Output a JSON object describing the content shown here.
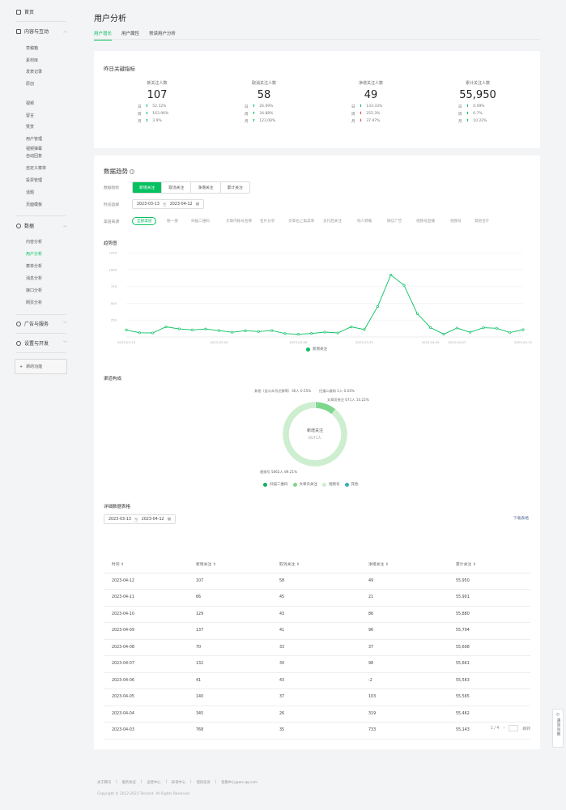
{
  "sidebar": {
    "home": "首页",
    "content": {
      "label": "内容与互动",
      "items": [
        "草稿箱",
        "素材库",
        "发表记录",
        "原创"
      ],
      "items2": [
        "视频",
        "留言",
        "赞赏",
        "用户管理",
        "视频弹幕"
      ],
      "items3": [
        "自动回复",
        "自定义菜单",
        "投票管理",
        "话题",
        "页面模板"
      ]
    },
    "data": {
      "label": "数据",
      "items": [
        "内容分析",
        "用户分析",
        "菜单分析",
        "消息分析",
        "接口分析",
        "网页分析"
      ],
      "active": "用户分析"
    },
    "ads": "广告与服务",
    "settings": "设置与开发",
    "add_feature": "新的功能"
  },
  "header": {
    "title": "用户分析",
    "tabs": [
      "用户增长",
      "用户属性",
      "常读用户分析"
    ],
    "active_tab": "用户增长"
  },
  "yesterday": {
    "title": "昨日关键指标",
    "stats": [
      {
        "label": "新关注人数",
        "value": "107",
        "day": "52.12%",
        "week": "163.96%",
        "month": "3.9%",
        "day_dir": "up",
        "week_dir": "up",
        "month_dir": "up"
      },
      {
        "label": "取消关注人数",
        "value": "58",
        "day": "26.09%",
        "week": "34.88%",
        "month": "123.08%",
        "day_dir": "up",
        "week_dir": "up",
        "month_dir": "up"
      },
      {
        "label": "净增关注人数",
        "value": "49",
        "day": "133.33%",
        "week": "255.3%",
        "month": "37.97%",
        "day_dir": "up",
        "week_dir": "down",
        "month_dir": "down"
      },
      {
        "label": "累计关注人数",
        "value": "55,950",
        "day": "0.09%",
        "week": "0.7%",
        "month": "10.22%",
        "day_dir": "up",
        "week_dir": "up",
        "month_dir": "up"
      }
    ],
    "row_labels": [
      "日",
      "周",
      "月"
    ]
  },
  "trend": {
    "title": "数据趋势",
    "indicator_label": "数据指标",
    "indicators": [
      "新增关注",
      "取消关注",
      "净增关注",
      "累计关注"
    ],
    "time_label": "时间选择",
    "date_from": "2023-03-13",
    "date_sep": "至",
    "date_to": "2023-04-12",
    "source_label": "渠道来源",
    "sources": [
      "全部渠道",
      "搜一搜",
      "扫描二维码",
      "文章内账号名称",
      "名片分享",
      "文章右上角菜单",
      "支付后关注",
      "他人转载",
      "微信广告",
      "视频号直播",
      "视频号",
      "其他合计"
    ],
    "chart_subtitle": "趋势图",
    "legend": "新增关注"
  },
  "sources_section": {
    "title": "渠道构成",
    "center_title": "新增关注",
    "center_value": "6571人",
    "labels": {
      "other": "其他（含公众号迁移等）36人 0.55%",
      "qr": "扫描二维码 1人 0.03%",
      "article": "文章页关注 671人 10.22%",
      "video": "视频号 5862人 89.21%"
    },
    "legend": [
      "扫描二维码",
      "文章页关注",
      "视频号",
      "其他"
    ]
  },
  "detail": {
    "title": "详细数据表格",
    "date_from": "2023-03-13",
    "date_sep": "至",
    "date_to": "2023-04-12",
    "download": "下载表格",
    "columns": [
      "时间",
      "新增关注",
      "取消关注",
      "净增关注",
      "累计关注"
    ],
    "rows": [
      [
        "2023-04-12",
        "107",
        "58",
        "49",
        "55,950"
      ],
      [
        "2023-04-11",
        "66",
        "45",
        "21",
        "55,901"
      ],
      [
        "2023-04-10",
        "129",
        "43",
        "86",
        "55,880"
      ],
      [
        "2023-04-09",
        "137",
        "41",
        "96",
        "55,794"
      ],
      [
        "2023-04-08",
        "70",
        "33",
        "37",
        "55,698"
      ],
      [
        "2023-04-07",
        "132",
        "34",
        "98",
        "55,661"
      ],
      [
        "2023-04-06",
        "41",
        "43",
        "-2",
        "55,563"
      ],
      [
        "2023-04-05",
        "140",
        "37",
        "103",
        "55,565"
      ],
      [
        "2023-04-04",
        "345",
        "26",
        "319",
        "55,462"
      ],
      [
        "2023-04-03",
        "768",
        "35",
        "733",
        "55,143"
      ]
    ],
    "pager": {
      "page": "1 / 4",
      "jump": "跳转"
    }
  },
  "footer": {
    "links": [
      "关于腾讯",
      "服务协议",
      "运营中心",
      "辟谣中心",
      "侵权投诉",
      "客服中心@wx.qq.com"
    ],
    "copyright": "Copyright © 2012-2023 Tencent. All Rights Reserved."
  },
  "feedback": "遇到问题",
  "colors": {
    "brand": "#07c160",
    "up": "#07c160",
    "down": "#e64340"
  },
  "chart_data": {
    "type": "line",
    "x": [
      "2023-03-13",
      "2023-03-14",
      "2023-03-15",
      "2023-03-16",
      "2023-03-17",
      "2023-03-18",
      "2023-03-19",
      "2023-03-20",
      "2023-03-21",
      "2023-03-22",
      "2023-03-23",
      "2023-03-24",
      "2023-03-25",
      "2023-03-26",
      "2023-03-27",
      "2023-03-28",
      "2023-03-29",
      "2023-03-30",
      "2023-03-31",
      "2023-04-01",
      "2023-04-02",
      "2023-04-03",
      "2023-04-04",
      "2023-04-05",
      "2023-04-06",
      "2023-04-07",
      "2023-04-08",
      "2023-04-09",
      "2023-04-10",
      "2023-04-11",
      "2023-04-12"
    ],
    "series": [
      {
        "name": "新增关注",
        "values": [
          105,
          62,
          60,
          150,
          120,
          105,
          118,
          95,
          70,
          92,
          80,
          95,
          50,
          40,
          52,
          72,
          60,
          150,
          110,
          450,
          920,
          768,
          345,
          140,
          41,
          132,
          70,
          137,
          129,
          66,
          107
        ]
      }
    ],
    "x_ticks": [
      "2023-03-13",
      "2023-03-20",
      "2023-03-26",
      "2023-03-31",
      "2023-04-05",
      "2023-04-07",
      "2023-04-12"
    ],
    "y_ticks": [
      250,
      500,
      750,
      1000,
      1250
    ],
    "ylim": [
      0,
      1250
    ],
    "grid": true,
    "legend_position": "bottom"
  },
  "donut_data": {
    "type": "pie",
    "categories": [
      "视频号",
      "文章页关注",
      "其他",
      "扫描二维码"
    ],
    "values": [
      5862,
      671,
      36,
      1
    ],
    "colors": [
      "#cdeecf",
      "#7fd68d",
      "#1aad60",
      "#36b0b8"
    ]
  }
}
